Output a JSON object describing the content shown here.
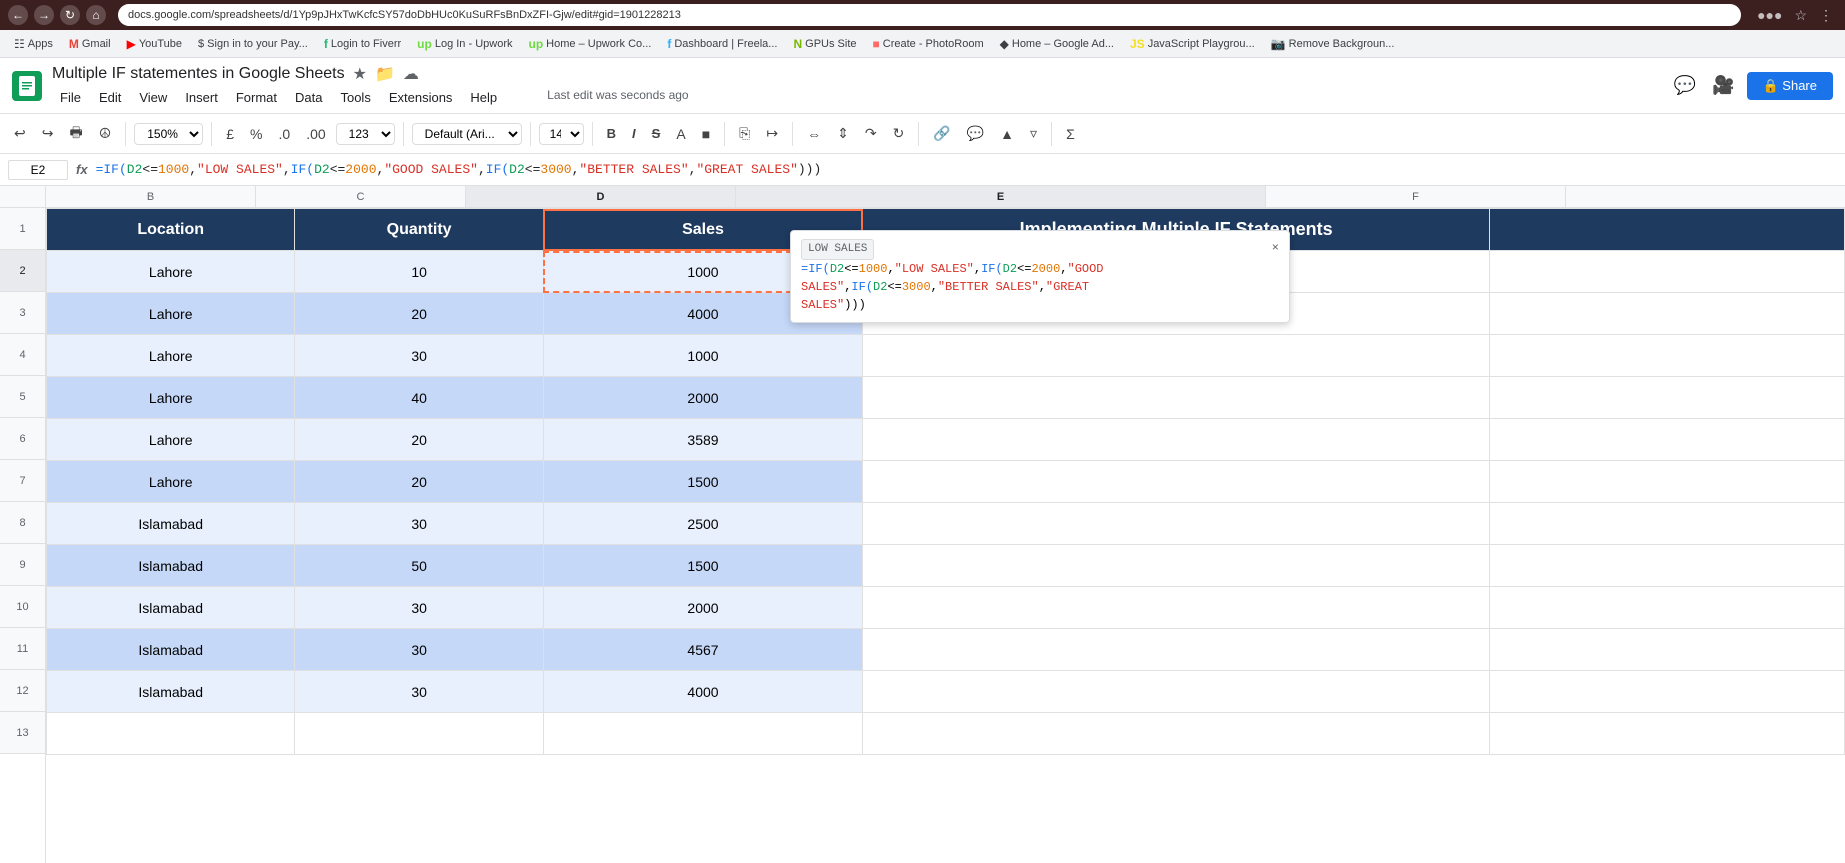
{
  "browser": {
    "url": "docs.google.com/spreadsheets/d/1Yp9pJHxTwKcfcSY57doDbHUc0KuSuRFsBnDxZFI-Gjw/edit#gid=1901228213",
    "nav_back": "←",
    "nav_forward": "→",
    "nav_reload": "↺",
    "nav_home": "⌂"
  },
  "bookmarks": [
    {
      "label": "Apps",
      "icon": "grid"
    },
    {
      "label": "Gmail",
      "icon": "mail"
    },
    {
      "label": "YouTube",
      "icon": "yt"
    },
    {
      "label": "Sign in to your Pay...",
      "icon": "pay"
    },
    {
      "label": "Login to Fiverr",
      "icon": "fiverr"
    },
    {
      "label": "Log In - Upwork",
      "icon": "upwork"
    },
    {
      "label": "Home – Upwork Co...",
      "icon": "upwork"
    },
    {
      "label": "Dashboard | Freela...",
      "icon": "free"
    },
    {
      "label": "GPUs Site",
      "icon": "gpu"
    },
    {
      "label": "Create - PhotoRoom",
      "icon": "photo"
    },
    {
      "label": "Home – Google Ad...",
      "icon": "google"
    },
    {
      "label": "JavaScript Playgrou...",
      "icon": "js"
    },
    {
      "label": "Remove Backgroun...",
      "icon": "bg"
    }
  ],
  "sheets": {
    "title": "Multiple IF statementes in Google Sheets",
    "last_edit": "Last edit was seconds ago",
    "menu_items": [
      "File",
      "Edit",
      "View",
      "Insert",
      "Format",
      "Data",
      "Tools",
      "Extensions",
      "Help"
    ]
  },
  "toolbar": {
    "zoom": "150%",
    "currency": "£",
    "percent": "%",
    "decimal_0": ".0",
    "decimal_00": ".00",
    "format": "123",
    "font_family": "Default (Ari...",
    "font_size": "14",
    "bold": "B",
    "italic": "I",
    "strikethrough": "S"
  },
  "formula_bar": {
    "cell_ref": "E2",
    "formula": "=IF(D2<=1000,\"LOW SALES\",IF(D2<=2000,\"GOOD SALES\",IF(D2<=3000,\"BETTER SALES\",\"GREAT SALES\")))"
  },
  "columns": {
    "headers": [
      "B",
      "C",
      "D",
      "E"
    ],
    "widths": [
      210,
      210,
      270,
      530
    ]
  },
  "header_row": {
    "location": "Location",
    "quantity": "Quantity",
    "sales": "Sales",
    "title": "Implementing Multiple IF Statements"
  },
  "data_rows": [
    {
      "row": 2,
      "location": "Lahore",
      "quantity": "10",
      "sales": "1000",
      "result": ""
    },
    {
      "row": 3,
      "location": "Lahore",
      "quantity": "20",
      "sales": "4000",
      "result": ""
    },
    {
      "row": 4,
      "location": "Lahore",
      "quantity": "30",
      "sales": "1000",
      "result": ""
    },
    {
      "row": 5,
      "location": "Lahore",
      "quantity": "40",
      "sales": "2000",
      "result": ""
    },
    {
      "row": 6,
      "location": "Lahore",
      "quantity": "20",
      "sales": "3589",
      "result": ""
    },
    {
      "row": 7,
      "location": "Lahore",
      "quantity": "20",
      "sales": "1500",
      "result": ""
    },
    {
      "row": 8,
      "location": "Islamabad",
      "quantity": "30",
      "sales": "2500",
      "result": ""
    },
    {
      "row": 9,
      "location": "Islamabad",
      "quantity": "50",
      "sales": "1500",
      "result": ""
    },
    {
      "row": 10,
      "location": "Islamabad",
      "quantity": "30",
      "sales": "2000",
      "result": ""
    },
    {
      "row": 11,
      "location": "Islamabad",
      "quantity": "30",
      "sales": "4567",
      "result": ""
    },
    {
      "row": 12,
      "location": "Islamabad",
      "quantity": "30",
      "sales": "4000",
      "result": ""
    }
  ],
  "tooltip": {
    "badge": "LOW SALES",
    "close": "×",
    "formula": "=IF(D2<=1000,\"LOW SALES\",IF(D2<=2000,\"GOOD SALES\",IF(D2<=3000,\"BETTER SALES\",\"GREAT SALES\")))"
  },
  "colors": {
    "header_bg": "#1e3a5f",
    "header_text": "#ffffff",
    "row_even": "#e8f0fe",
    "row_odd": "#c5d8f8",
    "selected_cell_border": "#ff7043",
    "share_btn": "#1a73e8"
  }
}
